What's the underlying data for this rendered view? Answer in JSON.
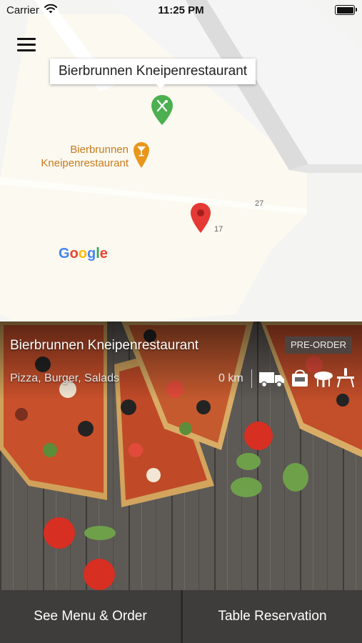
{
  "status_bar": {
    "carrier": "Carrier",
    "time": "11:25 PM"
  },
  "map": {
    "callout_title": "Bierbrunnen Kneipenrestaurant",
    "poi_label_line1": "Bierbrunnen",
    "poi_label_line2": "Kneipenrestaurant",
    "house_numbers": [
      "27",
      "17"
    ],
    "google_logo": [
      "G",
      "o",
      "o",
      "g",
      "l",
      "e"
    ],
    "colors": {
      "selected_pin": "#4cb050",
      "poi_pin": "#e8971c",
      "location_pin": "#e53935",
      "poi_label": "#c77a1c"
    }
  },
  "restaurant": {
    "name": "Bierbrunnen Kneipenrestaurant",
    "preorder_label": "PRE-ORDER",
    "cuisines": "Pizza, Burger, Salads",
    "distance": "0 km",
    "service_icons": [
      "delivery-truck-icon",
      "takeaway-bag-icon",
      "dine-in-table-icon",
      "table-reservation-icon"
    ]
  },
  "actions": {
    "menu_label": "See Menu & Order",
    "reservation_label": "Table Reservation"
  }
}
